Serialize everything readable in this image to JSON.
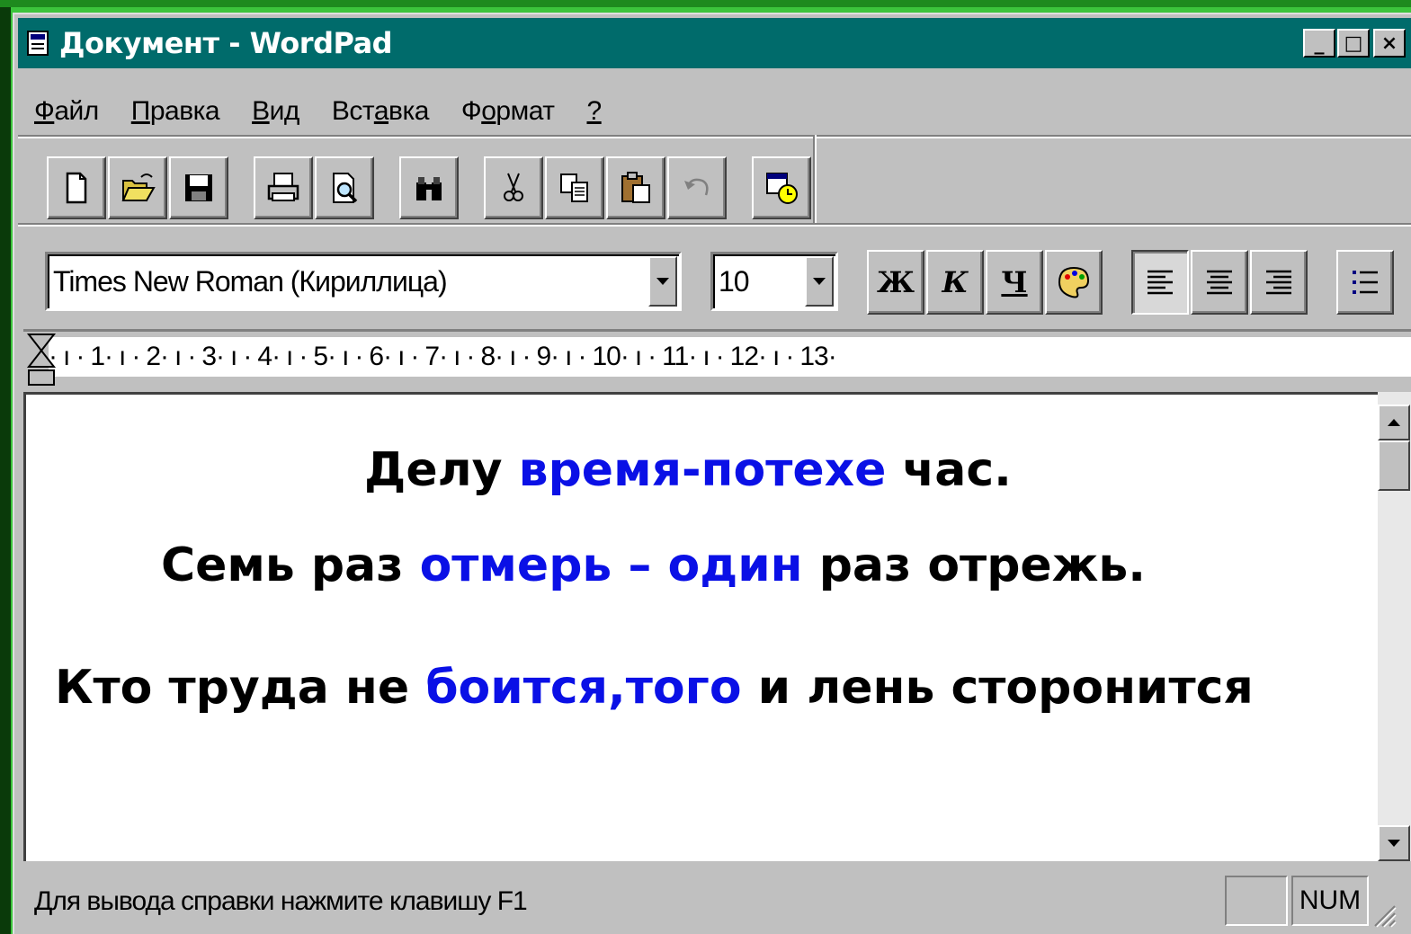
{
  "window": {
    "title": "Документ - WordPad",
    "controls": [
      "_",
      "□",
      "×"
    ]
  },
  "menu": [
    {
      "label": "Файл",
      "accel_index": 0
    },
    {
      "label": "Правка",
      "accel_index": 0
    },
    {
      "label": "Вид",
      "accel_index": 0
    },
    {
      "label": "Вставка",
      "accel_index": 3
    },
    {
      "label": "Формат",
      "accel_index": 1
    },
    {
      "label": "?",
      "accel_index": 0
    }
  ],
  "toolbar": {
    "buttons": [
      "new-icon",
      "open-icon",
      "save-icon",
      "print-icon",
      "print-preview-icon",
      "find-icon",
      "cut-icon",
      "copy-icon",
      "paste-icon",
      "undo-icon",
      "date-time-icon"
    ]
  },
  "format_bar": {
    "font": "Times New Roman (Кириллица)",
    "size": "10",
    "bold": "Ж",
    "italic": "К",
    "underline": "Ч",
    "alignment": "left"
  },
  "ruler": {
    "marks": [
      "1",
      "2",
      "3",
      "4",
      "5",
      "6",
      "7",
      "8",
      "9",
      "10",
      "11",
      "12",
      "13"
    ]
  },
  "document": {
    "lines": [
      {
        "parts": [
          {
            "text": "Делу ",
            "color": "#000000"
          },
          {
            "text": "время-потехе",
            "color": "#0a10e6"
          },
          {
            "text": " час.",
            "color": "#000000"
          }
        ]
      },
      {
        "parts": [
          {
            "text": "Семь раз ",
            "color": "#000000"
          },
          {
            "text": "отмерь – один",
            "color": "#0a10e6"
          },
          {
            "text": " раз отрежь.",
            "color": "#000000"
          }
        ]
      },
      {
        "parts": [
          {
            "text": "Кто труда не ",
            "color": "#000000"
          },
          {
            "text": "боится,того",
            "color": "#0a10e6"
          },
          {
            "text": " и лень сторонится",
            "color": "#000000"
          }
        ]
      }
    ]
  },
  "status": {
    "help_text": "Для вывода справки нажмите клавишу F1",
    "num_indicator": "NUM"
  },
  "colors": {
    "titlebar": "#006b6b",
    "accent_text": "#0a10e6",
    "background": "#3cc43c"
  }
}
